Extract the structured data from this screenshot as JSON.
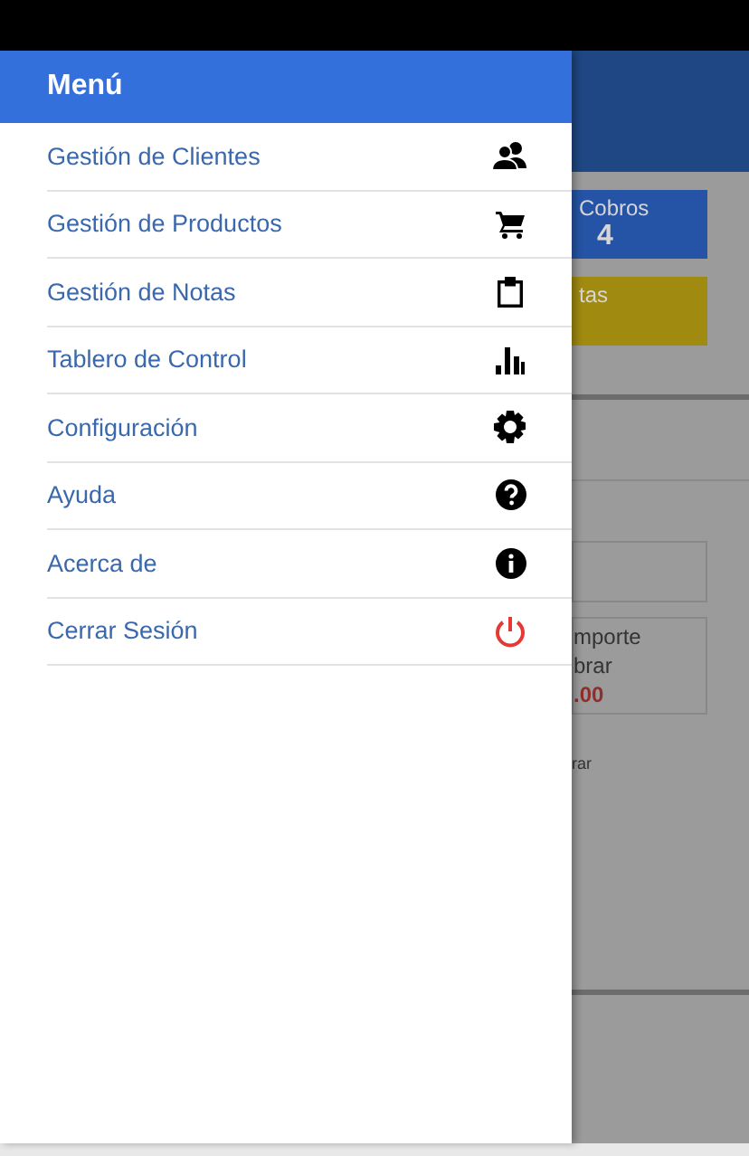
{
  "drawer": {
    "title": "Menú",
    "items": [
      {
        "label": "Gestión de Clientes"
      },
      {
        "label": "Gestión de Productos"
      },
      {
        "label": "Gestión de Notas"
      },
      {
        "label": "Tablero de Control"
      },
      {
        "label": "Configuración"
      },
      {
        "label": "Ayuda"
      },
      {
        "label": "Acerca de"
      },
      {
        "label": "Cerrar Sesión"
      }
    ]
  },
  "background": {
    "cards": [
      {
        "title": "Cobros",
        "value": "4",
        "color": "#2553a5"
      },
      {
        "title": "tas",
        "color": "#a08a10"
      }
    ],
    "amount_box": {
      "lines": [
        "mporte",
        "brar"
      ],
      "amount": ".00"
    },
    "link": "rar"
  }
}
